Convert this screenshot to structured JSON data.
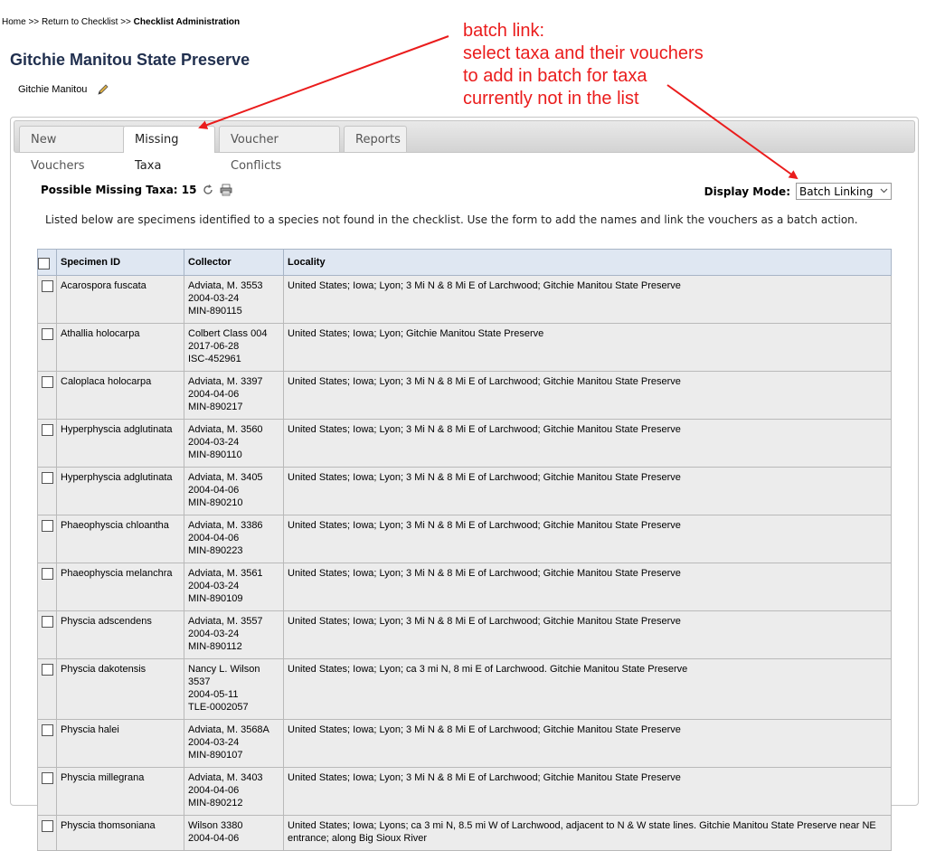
{
  "breadcrumb": {
    "home": "Home",
    "sep1": " >> ",
    "return": "Return to Checklist",
    "sep2": " >> ",
    "current": "Checklist Administration"
  },
  "page": {
    "title": "Gitchie Manitou State Preserve",
    "subtitle": "Gitchie Manitou"
  },
  "tabs": [
    {
      "label": "New Vouchers",
      "active": false
    },
    {
      "label": "Missing Taxa",
      "active": true
    },
    {
      "label": "Voucher Conflicts",
      "active": false
    },
    {
      "label": "Reports",
      "active": false
    }
  ],
  "missing": {
    "heading": "Possible Missing Taxa: 15",
    "display_mode_label": "Display Mode:",
    "display_mode_value": "Batch Linking",
    "instructions": "Listed below are specimens identified to a species not found in the checklist. Use the form to add the names and link the vouchers as a batch action."
  },
  "table": {
    "headers": [
      "Specimen ID",
      "Collector",
      "Locality"
    ],
    "rows": [
      {
        "taxon": "Acarospora fuscata",
        "collector": [
          "Adviata, M. 3553",
          "2004-03-24",
          "MIN-890115"
        ],
        "locality": "United States; Iowa; Lyon; 3 Mi N & 8 Mi E of Larchwood; Gitchie Manitou State Preserve"
      },
      {
        "taxon": "Athallia holocarpa",
        "collector": [
          "Colbert Class 004",
          "2017-06-28",
          "ISC-452961"
        ],
        "locality": "United States; Iowa; Lyon; Gitchie Manitou State Preserve"
      },
      {
        "taxon": "Caloplaca holocarpa",
        "collector": [
          "Adviata, M. 3397",
          "2004-04-06",
          "MIN-890217"
        ],
        "locality": "United States; Iowa; Lyon; 3 Mi N & 8 Mi E of Larchwood; Gitchie Manitou State Preserve"
      },
      {
        "taxon": "Hyperphyscia adglutinata",
        "collector": [
          "Adviata, M. 3560",
          "2004-03-24",
          "MIN-890110"
        ],
        "locality": "United States; Iowa; Lyon; 3 Mi N & 8 Mi E of Larchwood; Gitchie Manitou State Preserve"
      },
      {
        "taxon": "Hyperphyscia adglutinata",
        "collector": [
          "Adviata, M. 3405",
          "2004-04-06",
          "MIN-890210"
        ],
        "locality": "United States; Iowa; Lyon; 3 Mi N & 8 Mi E of Larchwood; Gitchie Manitou State Preserve"
      },
      {
        "taxon": "Phaeophyscia chloantha",
        "collector": [
          "Adviata, M. 3386",
          "2004-04-06",
          "MIN-890223"
        ],
        "locality": "United States; Iowa; Lyon; 3 Mi N & 8 Mi E of Larchwood; Gitchie Manitou State Preserve"
      },
      {
        "taxon": "Phaeophyscia melanchra",
        "collector": [
          "Adviata, M. 3561",
          "2004-03-24",
          "MIN-890109"
        ],
        "locality": "United States; Iowa; Lyon; 3 Mi N & 8 Mi E of Larchwood; Gitchie Manitou State Preserve"
      },
      {
        "taxon": "Physcia adscendens",
        "collector": [
          "Adviata, M. 3557",
          "2004-03-24",
          "MIN-890112"
        ],
        "locality": "United States; Iowa; Lyon; 3 Mi N & 8 Mi E of Larchwood; Gitchie Manitou State Preserve"
      },
      {
        "taxon": "Physcia dakotensis",
        "collector": [
          "Nancy L. Wilson",
          "3537",
          "2004-05-11",
          "TLE-0002057"
        ],
        "locality": "United States; Iowa; Lyon; ca 3 mi N, 8 mi E of Larchwood. Gitchie Manitou State Preserve"
      },
      {
        "taxon": "Physcia halei",
        "collector": [
          "Adviata, M. 3568A",
          "2004-03-24",
          "MIN-890107"
        ],
        "locality": "United States; Iowa; Lyon; 3 Mi N & 8 Mi E of Larchwood; Gitchie Manitou State Preserve"
      },
      {
        "taxon": "Physcia millegrana",
        "collector": [
          "Adviata, M. 3403",
          "2004-04-06",
          "MIN-890212"
        ],
        "locality": "United States; Iowa; Lyon; 3 Mi N & 8 Mi E of Larchwood; Gitchie Manitou State Preserve"
      },
      {
        "taxon": "Physcia thomsoniana",
        "collector": [
          "Wilson 3380",
          "2004-04-06"
        ],
        "locality": "United States; Iowa; Lyons; ca 3 mi N, 8.5 mi W of Larchwood, adjacent to N & W state lines. Gitchie Manitou State Preserve near NE entrance; along Big Sioux River"
      }
    ]
  },
  "annotation": {
    "lines": [
      "batch link:",
      "select taxa and their vouchers",
      "to add in batch for taxa",
      "currently not in the list"
    ],
    "color": "#ea1c1c"
  },
  "icons": {
    "edit": "pencil-icon",
    "refresh": "refresh-icon",
    "print": "print-icon",
    "dropdown": "chevron-down-icon"
  }
}
